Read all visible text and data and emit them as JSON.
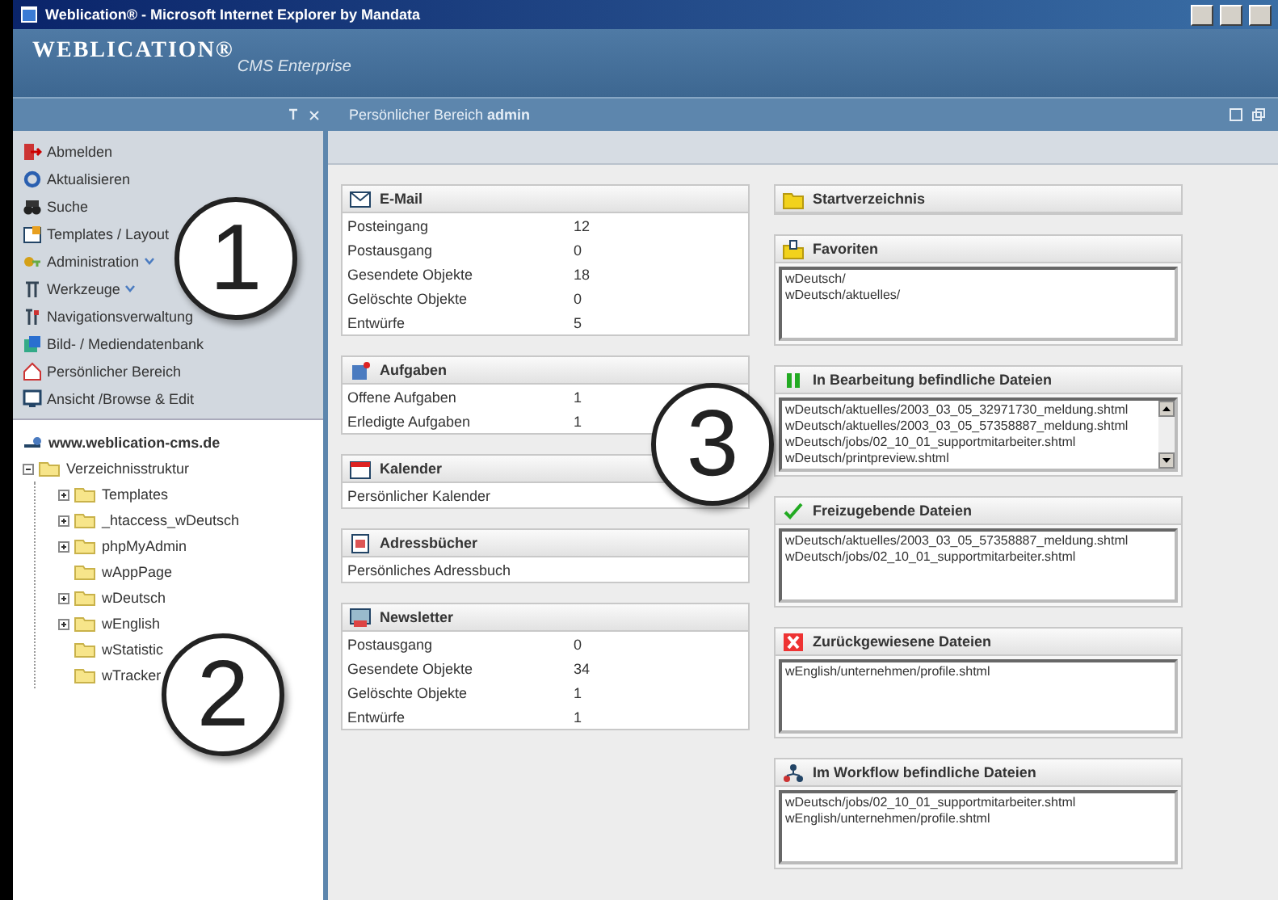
{
  "window": {
    "title": "Weblication® - Microsoft Internet Explorer by Mandata"
  },
  "header": {
    "logo": "WEBLICATION®",
    "edition": "CMS Enterprise"
  },
  "subbar": {
    "text": "Persönlicher Bereich **admin**"
  },
  "menu": [
    {
      "label": "Abmelden",
      "submenu": false
    },
    {
      "label": "Aktualisieren",
      "submenu": false
    },
    {
      "label": "Suche",
      "submenu": false
    },
    {
      "label": "Templates / Layout",
      "submenu": false
    },
    {
      "label": "Administration",
      "submenu": true
    },
    {
      "label": "Werkzeuge",
      "submenu": true
    },
    {
      "label": "Navigationsverwaltung",
      "submenu": false
    },
    {
      "label": "Bild- / Mediendatenbank",
      "submenu": false
    },
    {
      "label": "Persönlicher Bereich",
      "submenu": false
    },
    {
      "label": "Ansicht /Browse & Edit",
      "submenu": false
    }
  ],
  "tree": {
    "root": "www.weblication-cms.de",
    "items": [
      {
        "label": "Verzeichnisstruktur",
        "expanded": true,
        "children": [
          {
            "label": "Templates",
            "expanded": false
          },
          {
            "label": "_htaccess_wDeutsch",
            "expanded": false
          },
          {
            "label": "phpMyAdmin",
            "expanded": false
          },
          {
            "label": "wAppPage"
          },
          {
            "label": "wDeutsch",
            "expanded": false
          },
          {
            "label": "wEnglish",
            "expanded": false
          },
          {
            "label": "wStatistic"
          },
          {
            "label": "wTracker"
          }
        ]
      }
    ]
  },
  "columns": [
    [
      {
        "title": "E-Mail",
        "kind": "table",
        "rows": [
          {
            "label": "Posteingang",
            "value": "12"
          },
          {
            "label": "Postausgang",
            "value": "0"
          },
          {
            "label": "Gesendete Objekte",
            "value": "18"
          },
          {
            "label": "Gelöschte Objekte",
            "value": "0"
          },
          {
            "label": "Entwürfe",
            "value": "5"
          }
        ]
      },
      {
        "title": "Aufgaben",
        "kind": "table",
        "rows": [
          {
            "label": "Offene Aufgaben",
            "value": "1"
          },
          {
            "label": "Erledigte Aufgaben",
            "value": "1"
          }
        ]
      },
      {
        "title": "Kalender",
        "kind": "table",
        "rows": [
          {
            "label": "Persönlicher Kalender"
          }
        ]
      },
      {
        "title": "Adressbücher",
        "kind": "table",
        "rows": [
          {
            "label": "Persönliches Adressbuch"
          }
        ]
      },
      {
        "title": "Newsletter",
        "kind": "table",
        "rows": [
          {
            "label": "Postausgang",
            "value": "0"
          },
          {
            "label": "Gesendete Objekte",
            "value": "34"
          },
          {
            "label": "Gelöschte Objekte",
            "value": "1"
          },
          {
            "label": "Entwürfe",
            "value": "1"
          }
        ]
      }
    ],
    [
      {
        "title": "Startverzeichnis",
        "kind": "header"
      },
      {
        "title": "Favoriten",
        "kind": "list",
        "items": [
          "wDeutsch/",
          "wDeutsch/aktuelles/"
        ]
      },
      {
        "title": "In Bearbeitung befindliche Dateien",
        "kind": "list",
        "scrollable": true,
        "items": [
          "wDeutsch/aktuelles/2003_03_05_32971730_meldung.shtml",
          "wDeutsch/aktuelles/2003_03_05_57358887_meldung.shtml",
          "wDeutsch/jobs/02_10_01_supportmitarbeiter.shtml",
          "wDeutsch/printpreview.shtml"
        ]
      },
      {
        "title": "Freizugebende Dateien",
        "kind": "list",
        "items": [
          "wDeutsch/aktuelles/2003_03_05_57358887_meldung.shtml",
          "wDeutsch/jobs/02_10_01_supportmitarbeiter.shtml"
        ]
      },
      {
        "title": "Zurückgewiesene Dateien",
        "kind": "list",
        "items": [
          "wEnglish/unternehmen/profile.shtml"
        ]
      },
      {
        "title": "Im Workflow befindliche Dateien",
        "kind": "list",
        "items": [
          "wDeutsch/jobs/02_10_01_supportmitarbeiter.shtml",
          "wEnglish/unternehmen/profile.shtml"
        ]
      }
    ]
  ],
  "callouts": [
    {
      "label": "1"
    },
    {
      "label": "2"
    },
    {
      "label": "3"
    }
  ]
}
